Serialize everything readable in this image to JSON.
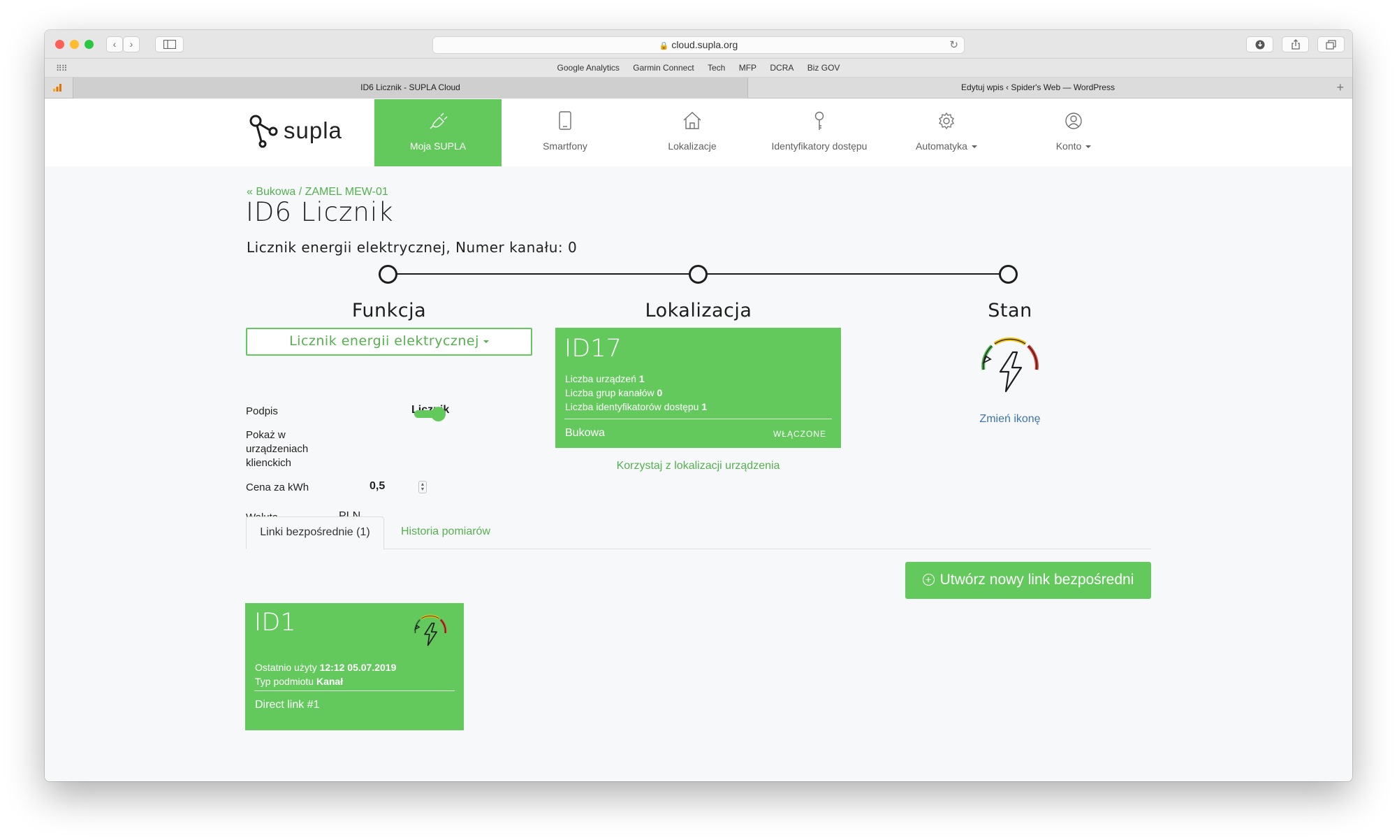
{
  "browser": {
    "url": "cloud.supla.org",
    "bookmarks": [
      "Google Analytics",
      "Garmin Connect",
      "Tech",
      "MFP",
      "DCRA",
      "Biz GOV"
    ],
    "tabs": [
      "ID6 Licznik - SUPLA Cloud",
      "Edytuj wpis ‹ Spider's Web — WordPress"
    ]
  },
  "nav": {
    "brand": "supla",
    "items": [
      {
        "label": "Moja SUPLA",
        "icon": "plug-icon"
      },
      {
        "label": "Smartfony",
        "icon": "smartphone-icon"
      },
      {
        "label": "Lokalizacje",
        "icon": "home-icon"
      },
      {
        "label": "Identyfikatory dostępu",
        "icon": "key-icon"
      },
      {
        "label": "Automatyka",
        "icon": "gear-icon"
      },
      {
        "label": "Konto",
        "icon": "user-icon"
      }
    ]
  },
  "page": {
    "breadcrumb": "« Bukowa / ZAMEL MEW-01",
    "title": "ID6 Licznik",
    "subtitle": "Licznik energii elektrycznej, Numer kanału: 0"
  },
  "funkcja": {
    "heading": "Funkcja",
    "selected": "Licznik energii elektrycznej",
    "fields": {
      "podpis_label": "Podpis",
      "podpis_value": "Licznik",
      "show_label": "Pokaż w urządzeniach klienckich",
      "show_enabled": true,
      "price_label": "Cena za kWh",
      "price_value": "0,5",
      "currency_label": "Waluta",
      "currency_value": "PLN"
    }
  },
  "lokalizacja": {
    "heading": "Lokalizacja",
    "card": {
      "id": "ID17",
      "devices_label": "Liczba urządzeń",
      "devices_value": "1",
      "groups_label": "Liczba grup kanałów",
      "groups_value": "0",
      "aids_label": "Liczba identyfikatorów dostępu",
      "aids_value": "1",
      "name": "Bukowa",
      "status": "WŁĄCZONE"
    },
    "use_device_location": "Korzystaj z lokalizacji urządzenia"
  },
  "stan": {
    "heading": "Stan",
    "icon": "electricity-meter-icon",
    "change_icon": "Zmień ikonę"
  },
  "tabs": {
    "links": "Linki bezpośrednie (1)",
    "history": "Historia pomiarów"
  },
  "create_link": "Utwórz nowy link bezpośredni",
  "direct_link": {
    "id": "ID1",
    "last_used_label": "Ostatnio użyty",
    "last_used_value": "12:12 05.07.2019",
    "subject_label": "Typ podmiotu",
    "subject_value": "Kanał",
    "name": "Direct link #1"
  },
  "colors": {
    "accent": "#63c95c",
    "accent_text": "#55b04f",
    "link_blue": "#3d74ae",
    "gauge_green": "#4caf50",
    "gauge_yellow": "#f2c200",
    "gauge_red": "#d9382b"
  }
}
